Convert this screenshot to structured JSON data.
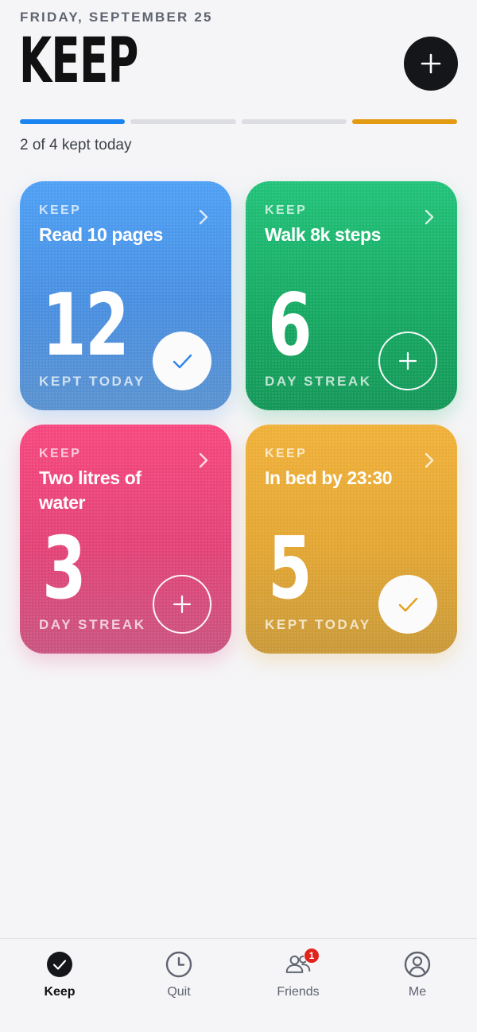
{
  "header": {
    "date": "FRIDAY, SEPTEMBER 25",
    "title": "KEEP",
    "kept_summary": "2 of 4 kept today",
    "kept_count": 2,
    "total_count": 4
  },
  "cards": [
    {
      "label": "KEEP",
      "name": "Read 10 pages",
      "number": "12",
      "sub": "KEPT TODAY",
      "state": "done",
      "color": "#4a8fe0"
    },
    {
      "label": "KEEP",
      "name": "Walk 8k steps",
      "number": "6",
      "sub": "DAY STREAK",
      "state": "todo",
      "color": "#17a862"
    },
    {
      "label": "KEEP",
      "name": "Two litres of water",
      "number": "3",
      "sub": "DAY STREAK",
      "state": "todo",
      "color": "#e24478"
    },
    {
      "label": "KEEP",
      "name": "In bed by 23:30",
      "number": "5",
      "sub": "KEPT TODAY",
      "state": "done",
      "color": "#e2a634"
    }
  ],
  "tabbar": {
    "tabs": [
      {
        "label": "Keep",
        "icon": "check-circle-icon",
        "active": true
      },
      {
        "label": "Quit",
        "icon": "clock-icon",
        "active": false
      },
      {
        "label": "Friends",
        "icon": "friends-icon",
        "active": false,
        "badge": "1"
      },
      {
        "label": "Me",
        "icon": "user-circle-icon",
        "active": false
      }
    ]
  },
  "colors": {
    "progress_done_1": "#1a84f0",
    "progress_done_2": "#e39b13",
    "progress_empty": "#dcdde2",
    "badge": "#e0241d"
  }
}
